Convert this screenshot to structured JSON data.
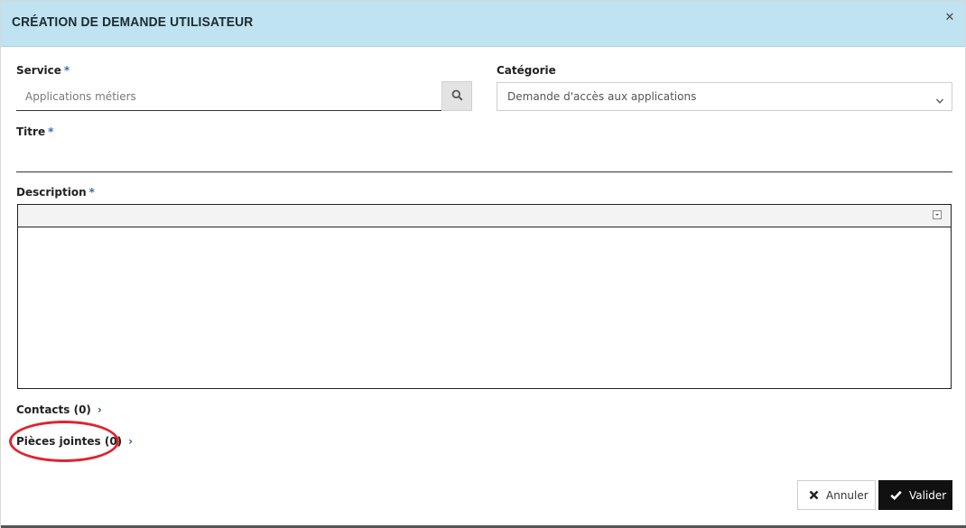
{
  "dialog": {
    "title": "CRÉATION DE DEMANDE UTILISATEUR",
    "close_icon": "close-icon"
  },
  "service": {
    "label": "Service",
    "required_mark": "*",
    "placeholder": "Applications métiers",
    "search_icon": "search-icon"
  },
  "category": {
    "label": "Catégorie",
    "value": "Demande d'accès aux applications",
    "chevron_icon": "chevron-down-icon"
  },
  "titre": {
    "label": "Titre",
    "required_mark": "*",
    "value": ""
  },
  "description": {
    "label": "Description",
    "required_mark": "*",
    "value": ""
  },
  "contacts": {
    "label": "Contacts (0)",
    "chevron": "›"
  },
  "attachments": {
    "label": "Pièces jointes (0)",
    "chevron": "›",
    "highlight_color": "#e0242e"
  },
  "actions": {
    "cancel_label": "Annuler",
    "cancel_icon": "x-icon",
    "submit_label": "Valider",
    "submit_icon": "check-icon"
  },
  "colors": {
    "header_bg": "#bfe3f0",
    "required": "#3a6fb0",
    "primary_button": "#111111"
  }
}
